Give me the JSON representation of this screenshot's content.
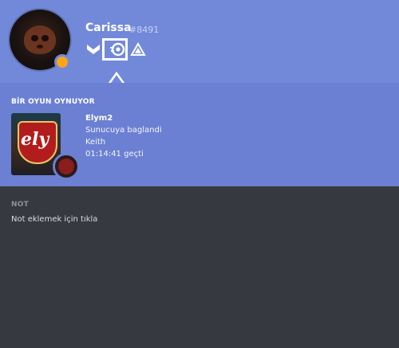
{
  "profile": {
    "username": "Carissa",
    "discriminator": "#8491",
    "status_color": "#faa61a",
    "badges": [
      "hypesquad-brilliance-icon",
      "nitro-boost-icon",
      "partner-icon"
    ]
  },
  "activity": {
    "section_title": "BİR OYUN OYNUYOR",
    "game_name": "Elym2",
    "details": "Sunucuya baglandi",
    "state": "Keith",
    "elapsed": "01:14:41 geçti",
    "art_text": "ely"
  },
  "note": {
    "section_title": "NOT",
    "placeholder": "Not eklemek için tıkla"
  },
  "colors": {
    "header_bg": "#7289da",
    "activity_bg": "#6b80d2",
    "body_bg": "#36393f"
  }
}
